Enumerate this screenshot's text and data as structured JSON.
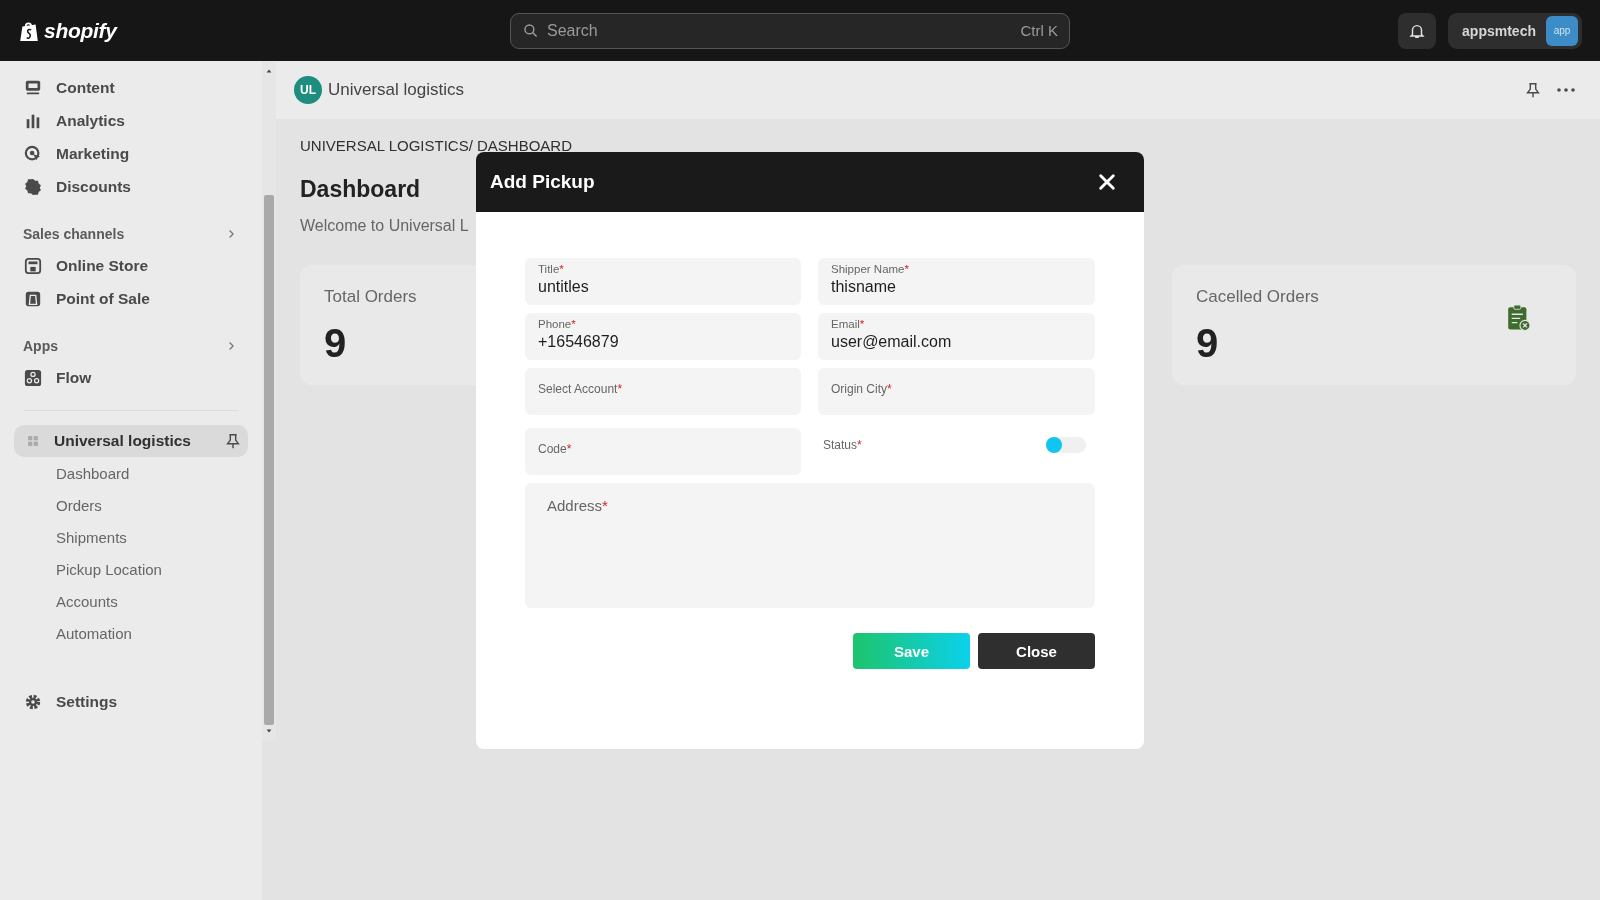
{
  "top_bar": {
    "logo": "shopify",
    "search": {
      "placeholder": "Search",
      "shortcut": "Ctrl K"
    },
    "account": {
      "name": "appsmtech",
      "badge": "app"
    }
  },
  "sidebar": {
    "groups": [
      {
        "items": [
          {
            "label": "Content",
            "selected": false
          },
          {
            "label": "Analytics",
            "selected": false
          },
          {
            "label": "Marketing",
            "selected": false
          },
          {
            "label": "Discounts",
            "selected": false
          }
        ]
      },
      {
        "heading": "Sales channels",
        "items": [
          {
            "label": "Online Store",
            "selected": false
          },
          {
            "label": "Point of Sale",
            "selected": false
          }
        ]
      },
      {
        "heading": "Apps",
        "items": [
          {
            "label": "Flow",
            "selected": false
          }
        ]
      }
    ],
    "app": {
      "label": "Universal logistics",
      "selected": true,
      "children": [
        {
          "label": "Dashboard",
          "selected": false
        },
        {
          "label": "Orders",
          "selected": false
        },
        {
          "label": "Shipments",
          "selected": false
        },
        {
          "label": "Pickup Location",
          "selected": false
        },
        {
          "label": "Accounts",
          "selected": false
        },
        {
          "label": "Automation",
          "selected": false
        }
      ]
    },
    "footer": {
      "label": "Settings",
      "selected": false
    }
  },
  "page_header": {
    "avatar": "UL",
    "title": "Universal logistics"
  },
  "content": {
    "breadcrumb": "UNIVERSAL LOGISTICS/ DASHBOARD",
    "heading": "Dashboard",
    "welcome": "Welcome to Universal L",
    "cards": [
      {
        "label": "Total Orders",
        "value": "9"
      },
      {
        "label": "Cacelled Orders",
        "value": "9",
        "has_icon": true
      }
    ]
  },
  "modal": {
    "title": "Add Pickup",
    "fields": [
      {
        "kind": "text",
        "label": "Title",
        "mark": "*",
        "value": "untitles"
      },
      {
        "kind": "text",
        "label": "Shipper Name",
        "mark": "*",
        "value": "thisname"
      },
      {
        "kind": "text",
        "label": "Phone",
        "mark": "*",
        "value": "+16546879"
      },
      {
        "kind": "text",
        "label": "Email",
        "mark": "*",
        "value": "user@email.com"
      },
      {
        "kind": "text",
        "label": "Select Account",
        "mark": "*"
      },
      {
        "kind": "text",
        "label": "Origin City",
        "mark": "*"
      },
      {
        "kind": "text",
        "label": "Code",
        "mark": "*"
      },
      {
        "kind": "toggle",
        "label": "Status",
        "mark": "*",
        "on": false
      },
      {
        "kind": "textarea",
        "label": "Address",
        "mark": "*"
      }
    ],
    "buttons": [
      {
        "label": "Save",
        "kind": "primary"
      },
      {
        "label": "Close",
        "kind": "secondary"
      }
    ]
  }
}
